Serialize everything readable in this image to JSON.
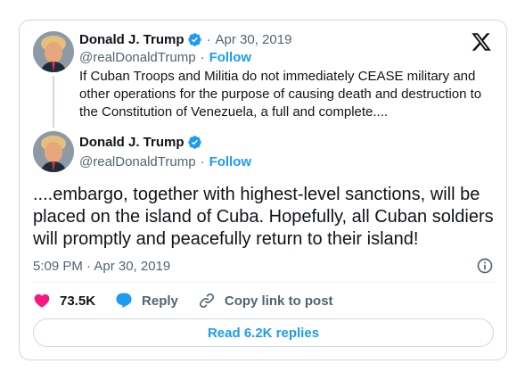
{
  "quoted_tweet": {
    "author_name": "Donald J. Trump",
    "date": "Apr 30, 2019",
    "handle": "@realDonaldTrump",
    "follow_label": "Follow",
    "text": "If Cuban Troops and Militia do not immediately CEASE military and other operations for the purpose of causing death and destruction to the Constitution of Venezuela, a full and complete...."
  },
  "main_tweet": {
    "author_name": "Donald J. Trump",
    "handle": "@realDonaldTrump",
    "follow_label": "Follow",
    "text": "....embargo, together with highest-level sanctions, will be placed on the island of Cuba. Hopefully, all Cuban soldiers will promptly and peacefully return to their island!",
    "timestamp": "5:09 PM · Apr 30, 2019"
  },
  "separator": "·",
  "actions": {
    "likes": "73.5K",
    "reply_label": "Reply",
    "copy_label": "Copy link to post"
  },
  "read_replies_label": "Read 6.2K replies",
  "colors": {
    "accent": "#1d9bf0",
    "like": "#f91880",
    "text": "#0f1419",
    "muted": "#536471",
    "border": "#cfd9de"
  },
  "icons": [
    "x-logo-icon",
    "verified-badge-icon",
    "info-icon",
    "heart-icon",
    "reply-bubble-icon",
    "link-icon"
  ]
}
